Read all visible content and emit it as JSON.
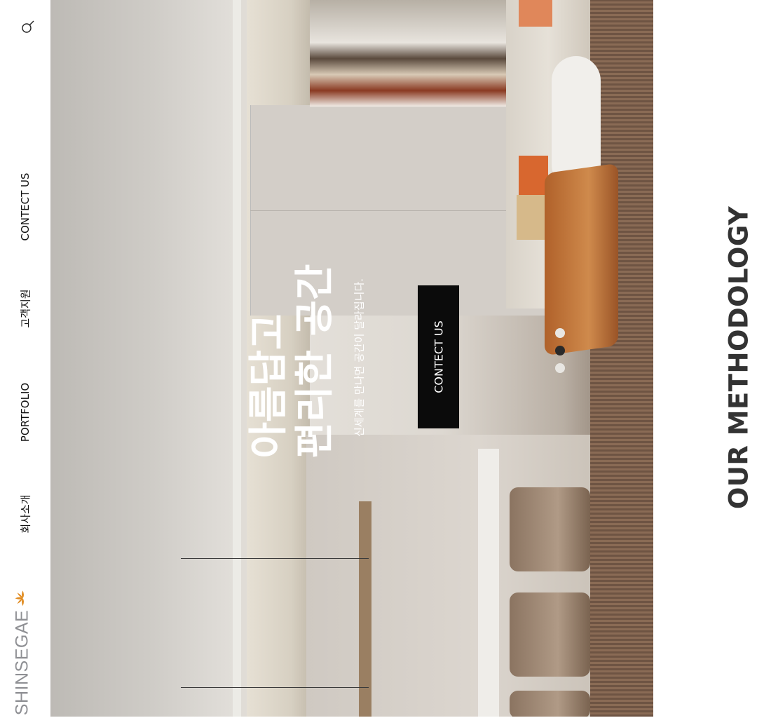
{
  "header": {
    "logo_text": "SHINSEGAE",
    "nav": [
      "회사소개",
      "PORTFOLIO",
      "고객지원",
      "CONTECT US"
    ],
    "search_icon": "search-icon"
  },
  "hero": {
    "title_line1": "아름답고",
    "title_line2": "편리한 공간",
    "subtitle": "신세계를 만나면 공간이 달라집니다.",
    "cta_label": "CONTECT US",
    "slides": 3,
    "active_slide": 2
  },
  "section": {
    "title": "OUR METHODOLOGY"
  },
  "colors": {
    "logo_gray": "#8f9094",
    "logo_orange": "#e08a1e",
    "cta_bg": "#0b0b0b",
    "text_dark": "#333333"
  }
}
